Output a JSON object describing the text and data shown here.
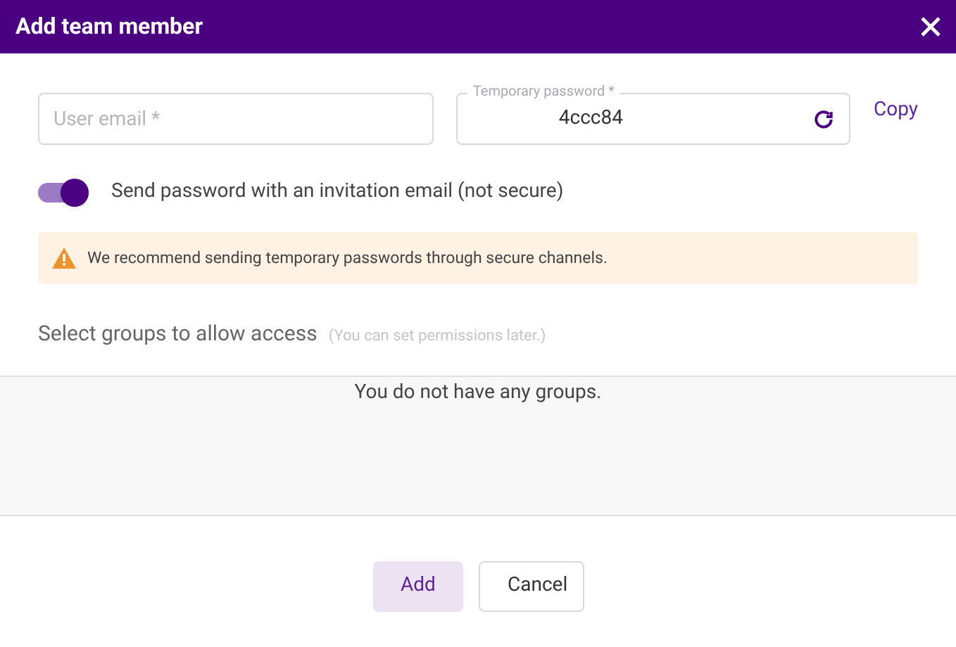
{
  "dialog": {
    "title": "Add team member"
  },
  "email_field": {
    "placeholder": "User email *"
  },
  "password_field": {
    "label": "Temporary password *",
    "value": "4ccc84"
  },
  "copy_link": "Copy",
  "send_invite": {
    "label": "Send password with an invitation email (not secure)",
    "on": true
  },
  "warning": "We recommend sending temporary passwords through secure channels.",
  "groups": {
    "title": "Select groups to allow access",
    "hint": "(You can set permissions later.)",
    "empty_text": "You do not have any groups."
  },
  "buttons": [
    {
      "label": "Add",
      "kind": "primary"
    },
    {
      "label": "Cancel",
      "kind": "secondary"
    }
  ]
}
